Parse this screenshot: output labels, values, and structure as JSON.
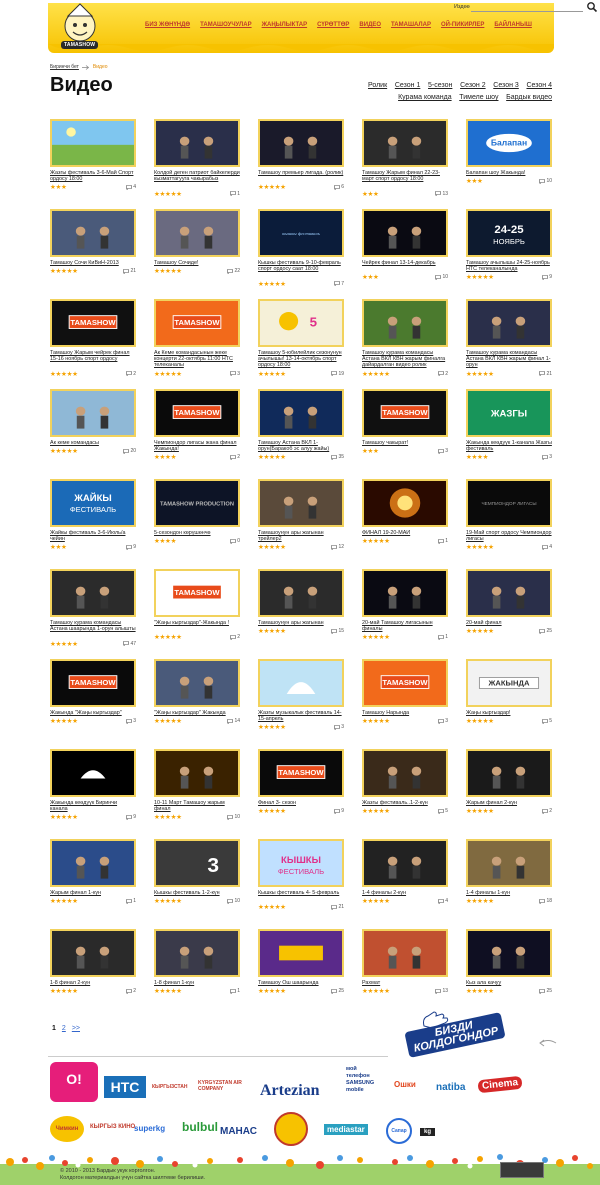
{
  "header": {
    "logo_text": "TAMASHOW",
    "search_label": "Издөө",
    "search_value": "",
    "nav": [
      "БИЗ ЖӨНҮНДӨ",
      "ТАМАШОУЧУЛАР",
      "ЖАҢЫЛЫКТАР",
      "СҮРӨТТӨР",
      "ВИДЕО",
      "ТАМАШАЛАР",
      "ОЙ-ПИКИРЛЕР",
      "БАЙЛАНЫШ"
    ]
  },
  "breadcrumb": {
    "home": "Биринчи бет",
    "current": "Видео"
  },
  "page_title": "Видео",
  "filters": [
    "Ролик",
    "Сезон 1",
    "5-сезон",
    "Сезон 2",
    "Сезон 3",
    "Сезон 4",
    "Курама команда",
    "Тимеле шоу",
    "Бардык видео"
  ],
  "videos": [
    {
      "title": "Жазгы фестиваль 3-6-Май Спорт ордосу 18:00",
      "stars": 3,
      "comments": "4",
      "thumb": "field"
    },
    {
      "title": "Колдой деген патриот байкелерди кызматтагууга чакырабыз",
      "stars": 5,
      "comments": "1",
      "thumb": "stage"
    },
    {
      "title": "Тамашоу премьер лигада. (ролик)",
      "stars": 5,
      "comments": "6",
      "thumb": "road"
    },
    {
      "title": "Тамашоу Жарым финал 22-23-март спорт ордосу 18:00",
      "stars": 3,
      "comments": "13",
      "thumb": "group"
    },
    {
      "title": "Балапан шоу Жакында!",
      "stars": 3,
      "comments": "10",
      "thumb": "balapan"
    },
    {
      "title": "Тамашоу Сочи КиВиН-2013",
      "stars": 5,
      "comments": "21",
      "thumb": "people"
    },
    {
      "title": "Тамашоу Сочиде!",
      "stars": 5,
      "comments": "22",
      "thumb": "crowd"
    },
    {
      "title": "Кышкы фестиваль 9-10-февраль спорт ордосу саат 18:00",
      "stars": 5,
      "comments": "7",
      "thumb": "kyshky"
    },
    {
      "title": "Чейрек финал 13-14-декабрь",
      "stars": 3,
      "comments": "10",
      "thumb": "dark"
    },
    {
      "title": "Тамашоу ачылышы 24-25-ноябрь НТС телеканалында",
      "stars": 5,
      "comments": "9",
      "thumb": "nov"
    },
    {
      "title": "Тамашоу Жарым чейрек финал 15-16 ноябрь спорт ордосу",
      "stars": 5,
      "comments": "2",
      "thumb": "tamashow"
    },
    {
      "title": "Ак Кеме командасынын жеке концерти 22-октябрь 11:00 НТС телеканалы",
      "stars": 5,
      "comments": "3",
      "thumb": "production"
    },
    {
      "title": "Тамашоу 5-юбилейлик сезонунун ачылышы! 13-14-октябрь спорт ордосу 18:00",
      "stars": 5,
      "comments": "19",
      "thumb": "poster"
    },
    {
      "title": "Тамашоу курама командасы Астана ВКЛ КВН жарым финалга дайардалган видео ролик",
      "stars": 5,
      "comments": "2",
      "thumb": "jungle"
    },
    {
      "title": "Тамашоу курама командасы Астана ВКЛ КВН жарым финал 1-орун",
      "stars": 5,
      "comments": "21",
      "thumb": "stage"
    },
    {
      "title": "Ак кеме командасы",
      "stars": 5,
      "comments": "20",
      "thumb": "sky"
    },
    {
      "title": "Чемпиондор лигасы жана финал Жакында!",
      "stars": 4,
      "comments": "2",
      "thumb": "tamashowdark"
    },
    {
      "title": "Тамашоу Астана ВКЛ 1-орун(Баракоб эс алуу жайы)",
      "stars": 5,
      "comments": "35",
      "thumb": "blue"
    },
    {
      "title": "Тамашоу чакырат!",
      "stars": 3,
      "comments": "3",
      "thumb": "tamashow"
    },
    {
      "title": "Жакында кеөдүүк 1-канала Жазгы фестиваль",
      "stars": 4,
      "comments": "3",
      "thumb": "jazgy"
    },
    {
      "title": "Жайкы фестиваль 3-6-Июль/а чейин",
      "stars": 3,
      "comments": "9",
      "thumb": "jaiky"
    },
    {
      "title": "5-сезондон көрүшөнчө",
      "stars": 4,
      "comments": "0",
      "thumb": "tamashowprod"
    },
    {
      "title": "Тамашоунун ары жагынан трейлер2",
      "stars": 5,
      "comments": "12",
      "thumb": "dance"
    },
    {
      "title": "ФИНАЛ 19-20-МАЙ",
      "stars": 5,
      "comments": "1",
      "thumb": "fire"
    },
    {
      "title": "19-Май спорт ордосу Чемпиондор лигасы",
      "stars": 5,
      "comments": "4",
      "thumb": "champ"
    },
    {
      "title": "Тамашоу курама командасы Астана шаарында 1-орун алышты",
      "stars": 5,
      "comments": "47",
      "thumb": "group"
    },
    {
      "title": "\"Жаңы кыргыздар\"-Жакында !",
      "stars": 5,
      "comments": "2",
      "thumb": "white"
    },
    {
      "title": "Тамашоунун ары жагынан",
      "stars": 5,
      "comments": "15",
      "thumb": "group"
    },
    {
      "title": "20-май Тамашоу лигасынын финалы",
      "stars": 5,
      "comments": "1",
      "thumb": "dark"
    },
    {
      "title": "20-май финал",
      "stars": 5,
      "comments": "25",
      "thumb": "stage"
    },
    {
      "title": "Жакында \"Жаңы кыргыздар\"",
      "stars": 5,
      "comments": "3",
      "thumb": "tamashowdark"
    },
    {
      "title": "\"Жаңы кыргыздар\" Жакында",
      "stars": 5,
      "comments": "14",
      "thumb": "people"
    },
    {
      "title": "Жазгы музыкалык фестиваль 14-15-апрель",
      "stars": 5,
      "comments": "3",
      "thumb": "yurt"
    },
    {
      "title": "Тамашоу Нарында",
      "stars": 5,
      "comments": "3",
      "thumb": "production"
    },
    {
      "title": "Жаңы кыргыздар!",
      "stars": 5,
      "comments": "5",
      "thumb": "jakynda"
    },
    {
      "title": "Жакында кеөдүүк Биринчи канала",
      "stars": 5,
      "comments": "9",
      "thumb": "ntsdark"
    },
    {
      "title": "10-11 Март Тамашоу жарым финал",
      "stars": 5,
      "comments": "10",
      "thumb": "orange"
    },
    {
      "title": "Финал 3- сезон",
      "stars": 5,
      "comments": "9",
      "thumb": "tamashowdark"
    },
    {
      "title": "Жазгы фестиваль..1-2-күн",
      "stars": 5,
      "comments": "5",
      "thumb": "singer"
    },
    {
      "title": "Жарым финал 2-күн",
      "stars": 5,
      "comments": "2",
      "thumb": "dancer"
    },
    {
      "title": "Жарым финал 1-күн",
      "stars": 5,
      "comments": "1",
      "thumb": "girl"
    },
    {
      "title": "Кышкы фестиваль 1-2-күн",
      "stars": 5,
      "comments": "10",
      "thumb": "three"
    },
    {
      "title": "Кышкы фестиваль 4- 5-февраль",
      "stars": 5,
      "comments": "21",
      "thumb": "kyshkyfest"
    },
    {
      "title": "1-4 финалы 2-күн",
      "stars": 5,
      "comments": "4",
      "thumb": "stagesmall"
    },
    {
      "title": "1-4 финалы 1-күн",
      "stars": 5,
      "comments": "18",
      "thumb": "speaker"
    },
    {
      "title": "1-8 финал 2-күн",
      "stars": 5,
      "comments": "2",
      "thumb": "man"
    },
    {
      "title": "1-8 финал 1-күн",
      "stars": 5,
      "comments": "1",
      "thumb": "show"
    },
    {
      "title": "Тамашоу Ош шаарында",
      "stars": 5,
      "comments": "25",
      "thumb": "colorful"
    },
    {
      "title": "Рахмат",
      "stars": 5,
      "comments": "13",
      "thumb": "kids"
    },
    {
      "title": "Кыз ала качуу",
      "stars": 5,
      "comments": "25",
      "thumb": "stage2"
    }
  ],
  "pagination": {
    "current": "1",
    "pages": [
      "2"
    ],
    "next": ">>"
  },
  "social": {
    "line1": "БИЗДИ",
    "line2": "КОЛДОГОНДОР"
  },
  "sponsors": [
    "O!",
    "НТС",
    "КЫРГЫЗСТАН",
    "KYRGYZSTAN AIR COMPANY",
    "Artezian",
    "мой телефон SAMSUNG mobile",
    "Ошки",
    "natiba",
    "Cinema",
    "Чимкин",
    "КЫРГЫЗ КИНО",
    "superkg",
    "bulbul",
    "МАНАС",
    "mediastar",
    "Сапар",
    "kg"
  ],
  "footer": {
    "line1": "© 2010 - 2013 Бардык укук корголгон.",
    "line2": "Колдогон материалдын үчүн сайтка шилтеме берилиши."
  },
  "colors": {
    "accent": "#f5a300",
    "header_bg": "#ffd23a",
    "link": "#222222",
    "nav": "#c0392b"
  }
}
